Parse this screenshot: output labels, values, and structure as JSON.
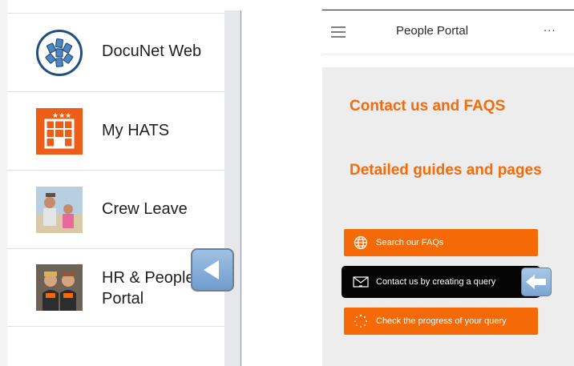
{
  "left_panel": {
    "apps": [
      {
        "label": "DocuNet Web",
        "icon": "docunet-logo-icon"
      },
      {
        "label": "My HATS",
        "icon": "hotel-building-icon"
      },
      {
        "label": "Crew Leave",
        "icon": "photo-thumbnail"
      },
      {
        "label_line1": "HR & People",
        "label_line2": "Portal",
        "icon": "photo-thumbnail"
      }
    ],
    "back_indicator": "left-triangle-icon"
  },
  "right_panel": {
    "header": {
      "title": "People Portal",
      "more_label": "...",
      "menu_icon": "hamburger-menu-icon"
    },
    "headings": [
      "Contact us and FAQS",
      "Detailed guides and pages"
    ],
    "buttons": [
      {
        "label": "Search our FAQs",
        "icon": "globe-icon",
        "style": "orange"
      },
      {
        "label": "Contact us by creating a query",
        "icon": "envelope-icon",
        "style": "black"
      },
      {
        "label": "Check the progress of your query",
        "icon": "spinner-icon",
        "style": "orange"
      }
    ],
    "pointer_indicator": "left-arrow-icon"
  },
  "colors": {
    "accent_orange": "#f56a07",
    "heading_orange": "#f36b0c",
    "indicator_blue": "#7aa5d3"
  }
}
